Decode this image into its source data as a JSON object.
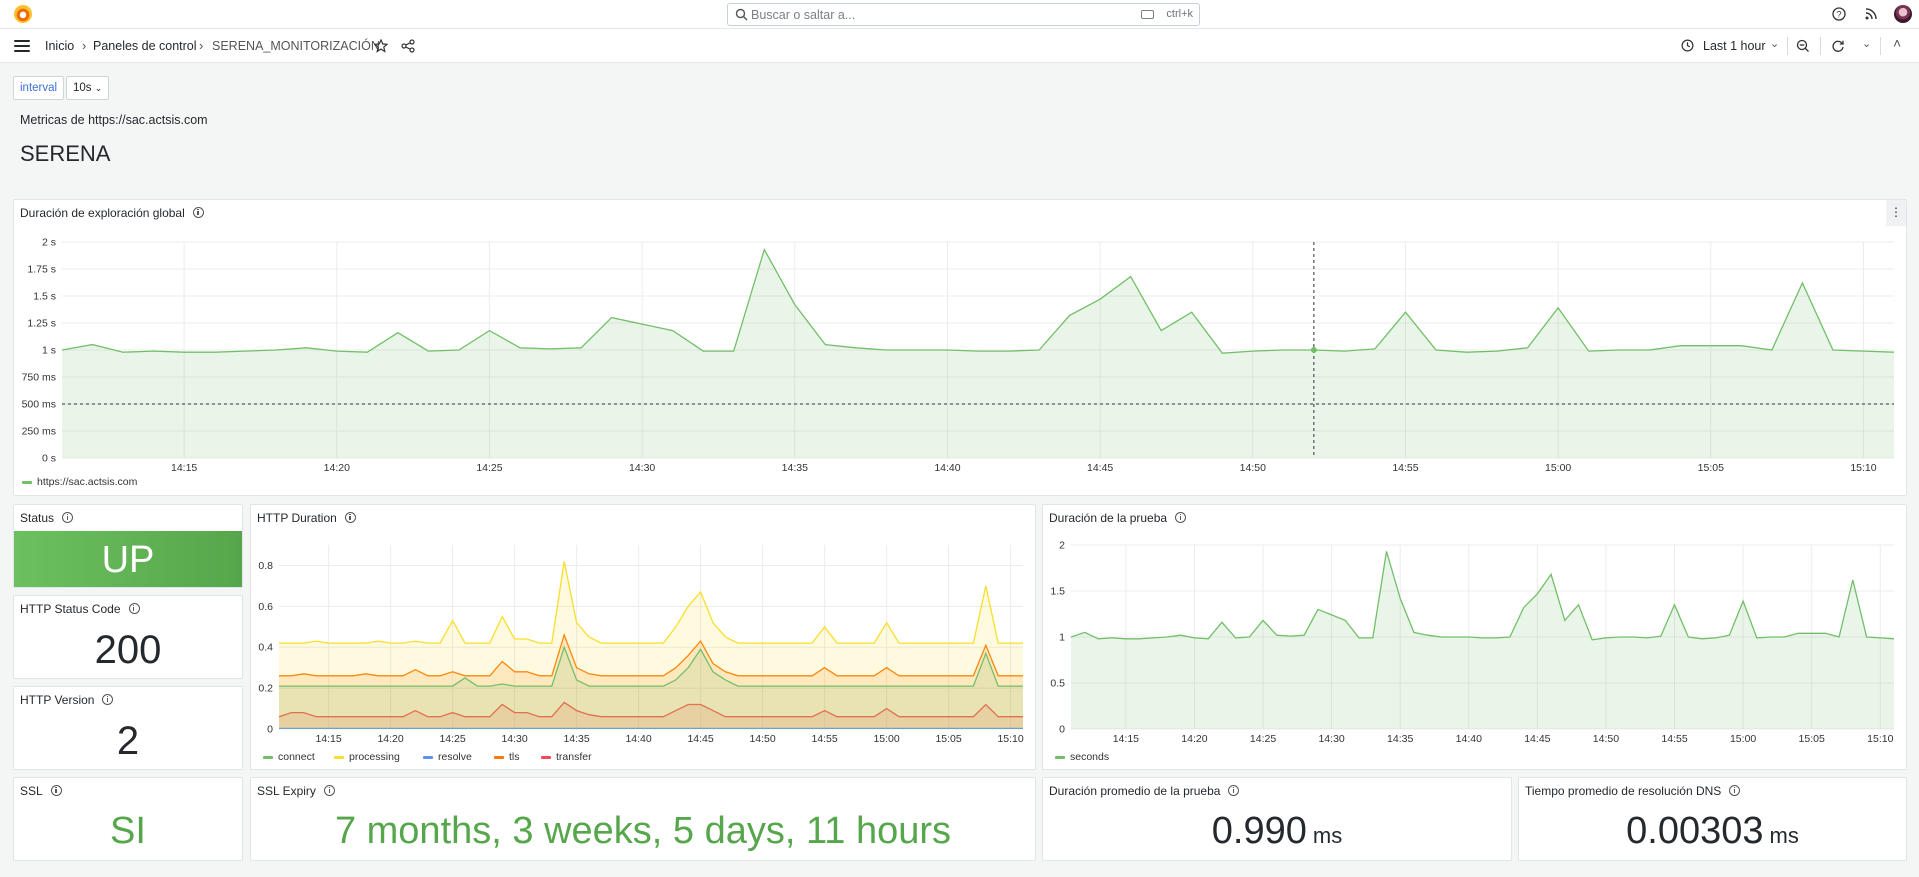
{
  "topbar": {
    "search_placeholder": "Buscar o saltar a...",
    "shortcut": "ctrl+k"
  },
  "breadcrumb": [
    "Inicio",
    "Paneles de control",
    "SERENA_MONITORIZACIÓN"
  ],
  "time_range": "Last 1 hour",
  "variables": {
    "label": "interval",
    "value": "10s"
  },
  "dashboard": {
    "subtitle": "Metricas de https://sac.actsis.com",
    "heading": "SERENA"
  },
  "stats": {
    "status": {
      "title": "Status",
      "value": "UP",
      "color": "#73bf69"
    },
    "http_status_code": {
      "title": "HTTP Status Code",
      "value": "200"
    },
    "http_version": {
      "title": "HTTP Version",
      "value": "2"
    },
    "ssl": {
      "title": "SSL",
      "value": "SI",
      "color": "#56a64b"
    },
    "ssl_expiry": {
      "title": "SSL Expiry",
      "value": "7 months, 3 weeks, 5 days, 11 hours",
      "color": "#56a64b"
    },
    "avg_probe": {
      "title": "Duración promedio de la prueba",
      "value": "0.990",
      "unit": "ms"
    },
    "avg_dns": {
      "title": "Tiempo promedio de resolución DNS",
      "value": "0.00303",
      "unit": "ms"
    }
  },
  "chart_data": [
    {
      "type": "area",
      "title": "Duración de exploración global",
      "y_ticks": [
        "0 s",
        "250 ms",
        "500 ms",
        "750 ms",
        "1 s",
        "1.25 s",
        "1.5 s",
        "1.75 s",
        "2 s"
      ],
      "ylim": [
        0,
        2
      ],
      "x_ticks": [
        "14:15",
        "14:20",
        "14:25",
        "14:30",
        "14:35",
        "14:40",
        "14:45",
        "14:50",
        "14:55",
        "15:00",
        "15:05",
        "15:10"
      ],
      "threshold": 0.5,
      "cursor_time": "14:52",
      "series": [
        {
          "name": "https://sac.actsis.com",
          "color": "#73bf69",
          "x": [
            "14:11",
            "14:12",
            "14:13",
            "14:14",
            "14:15",
            "14:16",
            "14:17",
            "14:18",
            "14:19",
            "14:20",
            "14:21",
            "14:22",
            "14:23",
            "14:24",
            "14:25",
            "14:26",
            "14:27",
            "14:28",
            "14:29",
            "14:30",
            "14:31",
            "14:32",
            "14:33",
            "14:34",
            "14:35",
            "14:36",
            "14:37",
            "14:38",
            "14:39",
            "14:40",
            "14:41",
            "14:42",
            "14:43",
            "14:44",
            "14:45",
            "14:46",
            "14:47",
            "14:48",
            "14:49",
            "14:50",
            "14:51",
            "14:52",
            "14:53",
            "14:54",
            "14:55",
            "14:56",
            "14:57",
            "14:58",
            "14:59",
            "15:00",
            "15:01",
            "15:02",
            "15:03",
            "15:04",
            "15:05",
            "15:06",
            "15:07",
            "15:08",
            "15:09",
            "15:10",
            "15:11"
          ],
          "y": [
            1.0,
            1.05,
            0.98,
            0.99,
            0.98,
            0.98,
            0.99,
            1.0,
            1.02,
            0.99,
            0.98,
            1.16,
            0.99,
            1.0,
            1.18,
            1.02,
            1.01,
            1.02,
            1.3,
            1.24,
            1.18,
            0.99,
            0.99,
            1.93,
            1.42,
            1.05,
            1.02,
            1.0,
            1.0,
            1.0,
            0.99,
            0.99,
            1.0,
            1.32,
            1.47,
            1.68,
            1.18,
            1.35,
            0.97,
            0.99,
            1.0,
            1.0,
            0.99,
            1.01,
            1.35,
            1.0,
            0.98,
            0.99,
            1.02,
            1.39,
            0.99,
            1.0,
            1.0,
            1.04,
            1.04,
            1.04,
            1.0,
            1.62,
            1.0,
            0.99,
            0.98
          ]
        }
      ]
    },
    {
      "type": "area",
      "title": "HTTP Duration",
      "y_ticks": [
        "0",
        "0.2",
        "0.4",
        "0.6",
        "0.8"
      ],
      "ylim": [
        0,
        0.9
      ],
      "x_ticks": [
        "14:15",
        "14:20",
        "14:25",
        "14:30",
        "14:35",
        "14:40",
        "14:45",
        "14:50",
        "14:55",
        "15:00",
        "15:05",
        "15:10"
      ],
      "series": [
        {
          "name": "connect",
          "color": "#73bf69",
          "y": [
            0.21,
            0.21,
            0.21,
            0.21,
            0.21,
            0.21,
            0.21,
            0.21,
            0.21,
            0.21,
            0.21,
            0.21,
            0.21,
            0.21,
            0.21,
            0.25,
            0.21,
            0.21,
            0.22,
            0.21,
            0.21,
            0.21,
            0.21,
            0.4,
            0.24,
            0.21,
            0.21,
            0.21,
            0.21,
            0.21,
            0.21,
            0.21,
            0.24,
            0.3,
            0.39,
            0.28,
            0.24,
            0.21,
            0.21,
            0.21,
            0.21,
            0.21,
            0.21,
            0.21,
            0.21,
            0.21,
            0.21,
            0.21,
            0.21,
            0.21,
            0.21,
            0.21,
            0.21,
            0.21,
            0.21,
            0.21,
            0.21,
            0.37,
            0.21,
            0.21,
            0.21
          ]
        },
        {
          "name": "processing",
          "color": "#fade2a",
          "y": [
            0.42,
            0.42,
            0.42,
            0.43,
            0.42,
            0.42,
            0.42,
            0.42,
            0.43,
            0.42,
            0.42,
            0.43,
            0.42,
            0.42,
            0.53,
            0.42,
            0.42,
            0.42,
            0.55,
            0.44,
            0.44,
            0.42,
            0.42,
            0.82,
            0.52,
            0.45,
            0.42,
            0.42,
            0.42,
            0.42,
            0.42,
            0.42,
            0.5,
            0.6,
            0.67,
            0.52,
            0.45,
            0.42,
            0.42,
            0.42,
            0.42,
            0.42,
            0.42,
            0.42,
            0.5,
            0.42,
            0.42,
            0.42,
            0.42,
            0.52,
            0.42,
            0.42,
            0.42,
            0.42,
            0.42,
            0.42,
            0.42,
            0.7,
            0.42,
            0.42,
            0.42
          ]
        },
        {
          "name": "resolve",
          "color": "#5794f2",
          "y": [
            0.003,
            0.003,
            0.003,
            0.003,
            0.003,
            0.003,
            0.003,
            0.003,
            0.003,
            0.003,
            0.003,
            0.003,
            0.003,
            0.003,
            0.003,
            0.003,
            0.003,
            0.003,
            0.003,
            0.003,
            0.003,
            0.003,
            0.003,
            0.003,
            0.003,
            0.003,
            0.003,
            0.003,
            0.003,
            0.003,
            0.003,
            0.003,
            0.003,
            0.003,
            0.003,
            0.003,
            0.003,
            0.003,
            0.003,
            0.003,
            0.003,
            0.003,
            0.003,
            0.003,
            0.003,
            0.003,
            0.003,
            0.003,
            0.003,
            0.003,
            0.003,
            0.003,
            0.003,
            0.003,
            0.003,
            0.003,
            0.003,
            0.003,
            0.003,
            0.003,
            0.003
          ]
        },
        {
          "name": "tls",
          "color": "#ff780a",
          "y": [
            0.26,
            0.26,
            0.27,
            0.26,
            0.26,
            0.26,
            0.26,
            0.27,
            0.26,
            0.26,
            0.26,
            0.29,
            0.26,
            0.26,
            0.28,
            0.26,
            0.26,
            0.26,
            0.33,
            0.28,
            0.28,
            0.26,
            0.26,
            0.46,
            0.3,
            0.27,
            0.26,
            0.26,
            0.26,
            0.26,
            0.26,
            0.26,
            0.3,
            0.36,
            0.43,
            0.32,
            0.28,
            0.26,
            0.26,
            0.26,
            0.26,
            0.26,
            0.26,
            0.26,
            0.3,
            0.26,
            0.26,
            0.26,
            0.26,
            0.3,
            0.26,
            0.26,
            0.26,
            0.26,
            0.26,
            0.26,
            0.26,
            0.41,
            0.26,
            0.26,
            0.26
          ]
        },
        {
          "name": "transfer",
          "color": "#f2495c",
          "y": [
            0.06,
            0.08,
            0.08,
            0.06,
            0.06,
            0.06,
            0.06,
            0.06,
            0.06,
            0.06,
            0.06,
            0.09,
            0.06,
            0.06,
            0.08,
            0.06,
            0.06,
            0.06,
            0.12,
            0.08,
            0.08,
            0.06,
            0.06,
            0.13,
            0.09,
            0.07,
            0.06,
            0.06,
            0.06,
            0.06,
            0.06,
            0.06,
            0.09,
            0.12,
            0.12,
            0.09,
            0.06,
            0.06,
            0.06,
            0.06,
            0.06,
            0.06,
            0.06,
            0.06,
            0.09,
            0.06,
            0.06,
            0.06,
            0.06,
            0.1,
            0.06,
            0.06,
            0.06,
            0.06,
            0.06,
            0.06,
            0.06,
            0.12,
            0.06,
            0.06,
            0.06
          ]
        }
      ]
    },
    {
      "type": "area",
      "title": "Duración de la prueba",
      "y_ticks": [
        "0",
        "0.5",
        "1",
        "1.5",
        "2"
      ],
      "ylim": [
        0,
        2
      ],
      "x_ticks": [
        "14:15",
        "14:20",
        "14:25",
        "14:30",
        "14:35",
        "14:40",
        "14:45",
        "14:50",
        "14:55",
        "15:00",
        "15:05",
        "15:10"
      ],
      "series": [
        {
          "name": "seconds",
          "color": "#73bf69",
          "y": [
            1.0,
            1.05,
            0.98,
            0.99,
            0.98,
            0.98,
            0.99,
            1.0,
            1.02,
            0.99,
            0.98,
            1.16,
            0.99,
            1.0,
            1.18,
            1.02,
            1.01,
            1.02,
            1.3,
            1.24,
            1.18,
            0.99,
            0.99,
            1.93,
            1.42,
            1.05,
            1.02,
            1.0,
            1.0,
            1.0,
            0.99,
            0.99,
            1.0,
            1.32,
            1.47,
            1.68,
            1.18,
            1.35,
            0.97,
            0.99,
            1.0,
            1.0,
            0.99,
            1.01,
            1.35,
            1.0,
            0.98,
            0.99,
            1.02,
            1.39,
            0.99,
            1.0,
            1.0,
            1.04,
            1.04,
            1.04,
            1.0,
            1.62,
            1.0,
            0.99,
            0.98
          ]
        }
      ]
    }
  ]
}
